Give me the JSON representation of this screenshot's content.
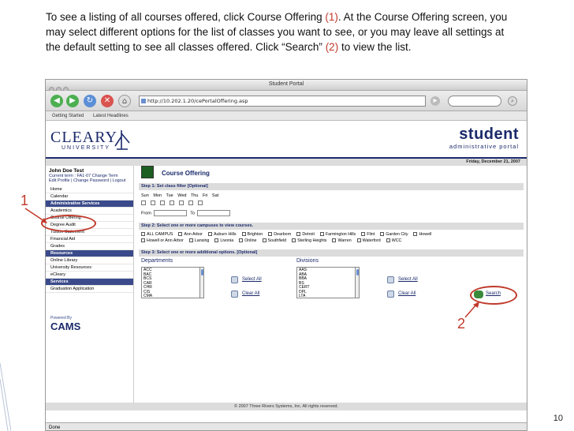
{
  "instructions": {
    "part1": "To see a listing of all courses offered, click Course Offering ",
    "ref1": "(1)",
    "part2": ".  At the Course Offering screen, you may select different options for the list of classes you want to see, or you may leave all settings at the default setting to see all classes offered. Click “Search” ",
    "ref2": "(2)",
    "part3": " to view the list."
  },
  "browser": {
    "window_title": "Student Portal",
    "url": "http://10.202.1.20/cePortalOffering.asp",
    "bookmarks": [
      "Getting Started",
      "Latest Headlines"
    ],
    "status": "Done"
  },
  "header": {
    "logo_main": "CLEARY",
    "logo_sub": "UNIVERSITY",
    "brand": "student",
    "brand_sub": "administrative portal",
    "date": "Friday, December 21, 2007"
  },
  "sidebar": {
    "user": "John Doe Test",
    "term": "Current term : FA1-07 Change Term",
    "links": "Edit Profile | Change Password | Logout",
    "nav": [
      {
        "label": "Home",
        "section": false
      },
      {
        "label": "Calendar",
        "section": false
      },
      {
        "label": "Administrative Services",
        "section": true
      },
      {
        "label": "Academics",
        "section": false
      },
      {
        "label": "Course Offering",
        "section": false
      },
      {
        "label": "Degree Audit",
        "section": false
      },
      {
        "label": "Tuition Statement",
        "section": false
      },
      {
        "label": "Financial Aid",
        "section": false
      },
      {
        "label": "Grades",
        "section": false
      },
      {
        "label": "Resources",
        "section": true
      },
      {
        "label": "Online Library",
        "section": false
      },
      {
        "label": "University Resources",
        "section": false
      },
      {
        "label": "eCleary",
        "section": false
      },
      {
        "label": "Services",
        "section": true
      },
      {
        "label": "Graduation Application",
        "section": false
      }
    ],
    "powered_by": "Powered By",
    "cams": "CAMS"
  },
  "main": {
    "title": "Course Offering",
    "step1": "Step 1: Set class filter [Optional]",
    "days": [
      "Sun",
      "Mon",
      "Tue",
      "Wed",
      "Thu",
      "Fri",
      "Sat"
    ],
    "from_label": "From",
    "to_label": "To",
    "step2": "Step 2: Select one or more campuses to view courses.",
    "campuses_line1": [
      "ALL CAMPUS",
      "Ann Arbor",
      "Auburn Hills",
      "Brighton",
      "Dearborn",
      "Detroit",
      "Farmington Hills",
      "Flint",
      "Garden City",
      "Howell"
    ],
    "campuses_line2": [
      "Howell or Ann Arbor",
      "Lansing",
      "Livonia",
      "Online",
      "Southfield",
      "Sterling Heights",
      "Warren",
      "Waterford",
      "WCC"
    ],
    "step3": "Step 3: Select one or more additional options. [Optional]",
    "departments_label": "Departments",
    "departments": [
      "ACC",
      "BAC",
      "BCS",
      "CAR",
      "CHR",
      "CIS",
      "CMA"
    ],
    "divisions_label": "Divisions",
    "divisions": [
      "AAS",
      "ABA",
      "BBA",
      "BS",
      "CERT",
      "DPL",
      "LTA"
    ],
    "select_all": "Select All",
    "clear_all": "Clear All",
    "search": "Search",
    "footer": "© 2007 Three Rivers Systems, Inc. All rights reserved."
  },
  "annotations": {
    "one": "1",
    "two": "2",
    "accent_color": "#c0392b"
  },
  "slide_number": "10"
}
